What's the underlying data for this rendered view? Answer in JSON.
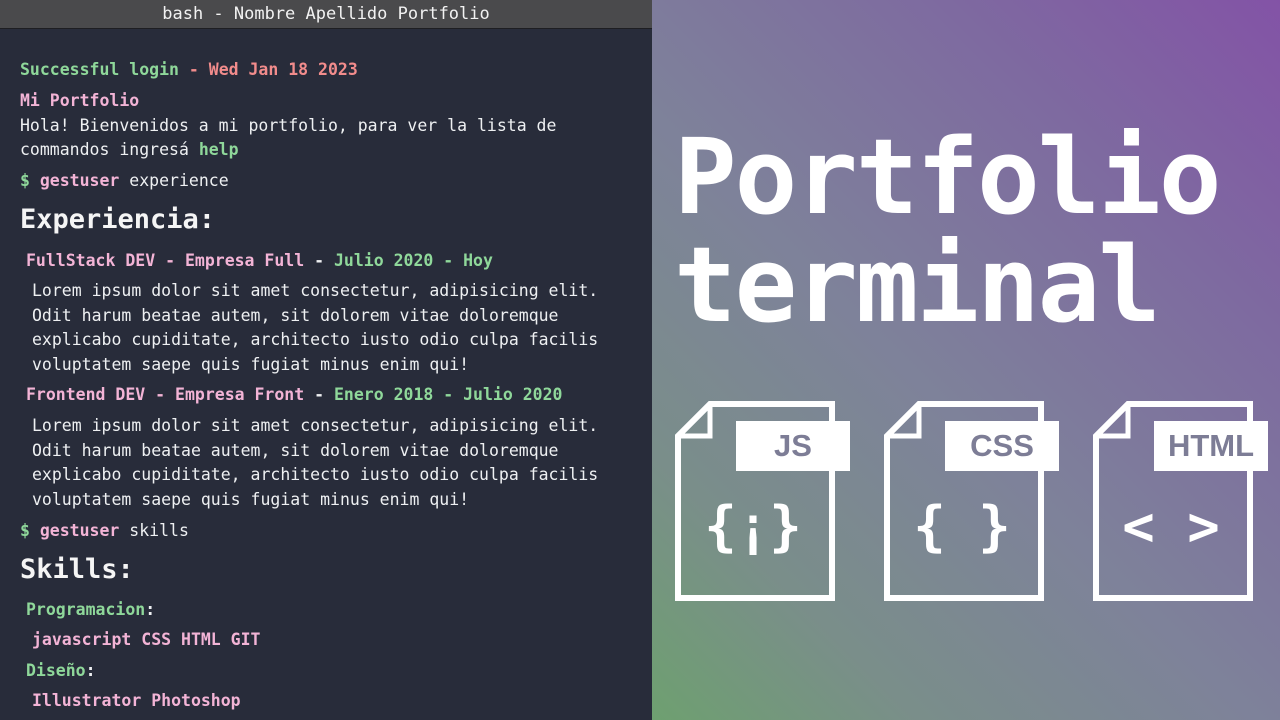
{
  "window": {
    "title": "bash - Nombre Apellido Portfolio"
  },
  "terminal": {
    "login": {
      "status": "Successful login",
      "separator": " - ",
      "date": "Wed Jan 18 2023"
    },
    "motd_title": "Mi Portfolio",
    "welcome_line1": "Hola! Bienvenidos a mi portfolio, para ver la lista de",
    "welcome_line2_prefix": "commandos ingresá ",
    "welcome_line2_cmd": "help",
    "prompt_symbol": "$",
    "prompt_user": "gestuser",
    "command1": "experience",
    "experience_heading": "Experiencia:",
    "jobs": [
      {
        "role": "FullStack DEV",
        "company": "Empresa Full",
        "dash": " - ",
        "period": "Julio 2020 - Hoy",
        "description": "Lorem ipsum dolor sit amet consectetur, adipisicing elit. Odit harum beatae autem, sit dolorem vitae doloremque explicabo cupiditate, architecto iusto odio culpa facilis voluptatem saepe quis fugiat minus enim qui!"
      },
      {
        "role": "Frontend DEV",
        "company": "Empresa Front",
        "dash": " - ",
        "period": "Enero 2018 - Julio 2020",
        "description": "Lorem ipsum dolor sit amet consectetur, adipisicing elit. Odit harum beatae autem, sit dolorem vitae doloremque explicabo cupiditate, architecto iusto odio culpa facilis voluptatem saepe quis fugiat minus enim qui!"
      }
    ],
    "command2": "skills",
    "skills_heading": "Skills:",
    "skill_groups": [
      {
        "name": "Programacion",
        "items": "javascript CSS HTML GIT"
      },
      {
        "name": "Diseño",
        "items": "Illustrator Photoshop"
      }
    ],
    "colon": ":"
  },
  "promo": {
    "title_line1": "Portfolio",
    "title_line2": "terminal",
    "files": [
      {
        "label": "JS",
        "glyph": "{¡}",
        "icon": "js-file-icon"
      },
      {
        "label": "CSS",
        "glyph": "{ }",
        "icon": "css-file-icon"
      },
      {
        "label": "HTML",
        "glyph": "< >",
        "icon": "html-file-icon"
      }
    ]
  },
  "colors": {
    "terminal_bg": "#282c3a",
    "green": "#8fd89a",
    "red": "#f28c8c",
    "pink": "#f3b4d6",
    "gradient_start": "#8353a6",
    "gradient_end": "#6ea070"
  }
}
